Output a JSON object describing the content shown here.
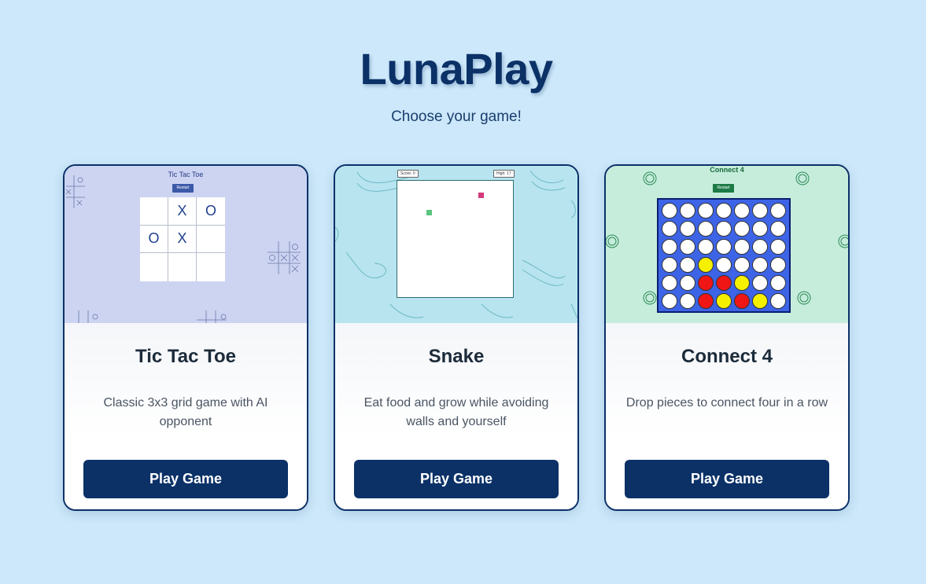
{
  "header": {
    "title": "LunaPlay",
    "tagline": "Choose your game!"
  },
  "colors": {
    "background": "#cce8fa",
    "primary": "#0b3167",
    "ttt_bg": "#ccd4f2",
    "snake_bg": "#b7e4ef",
    "c4_bg": "#c6eddc",
    "c4_board": "#3d64e6",
    "c4_red": "#f01616",
    "c4_yellow": "#f5f000",
    "snake_food": "#d23a7a",
    "snake_body": "#5bc47e"
  },
  "cards": [
    {
      "title": "Tic Tac Toe",
      "description": "Classic 3x3 grid game with AI opponent",
      "button": "Play Game",
      "preview": {
        "title": "Tic Tac Toe",
        "reset": "Restart",
        "board": [
          "",
          "X",
          "O",
          "O",
          "X",
          "",
          "",
          "",
          ""
        ]
      }
    },
    {
      "title": "Snake",
      "description": "Eat food and grow while avoiding walls and yourself",
      "button": "Play Game",
      "preview": {
        "score": "Score: 0",
        "high": "High: 17"
      }
    },
    {
      "title": "Connect 4",
      "description": "Drop pieces to connect four in a row",
      "button": "Play Game",
      "preview": {
        "title": "Connect 4",
        "reset": "Restart",
        "grid": [
          [
            "",
            "",
            "",
            "",
            "",
            "",
            ""
          ],
          [
            "",
            "",
            "",
            "",
            "",
            "",
            ""
          ],
          [
            "",
            "",
            "",
            "",
            "",
            "",
            ""
          ],
          [
            "",
            "",
            "Y",
            "",
            "",
            "",
            ""
          ],
          [
            "",
            "",
            "R",
            "R",
            "Y",
            "",
            ""
          ],
          [
            "",
            "",
            "R",
            "Y",
            "R",
            "Y",
            ""
          ]
        ]
      }
    }
  ]
}
